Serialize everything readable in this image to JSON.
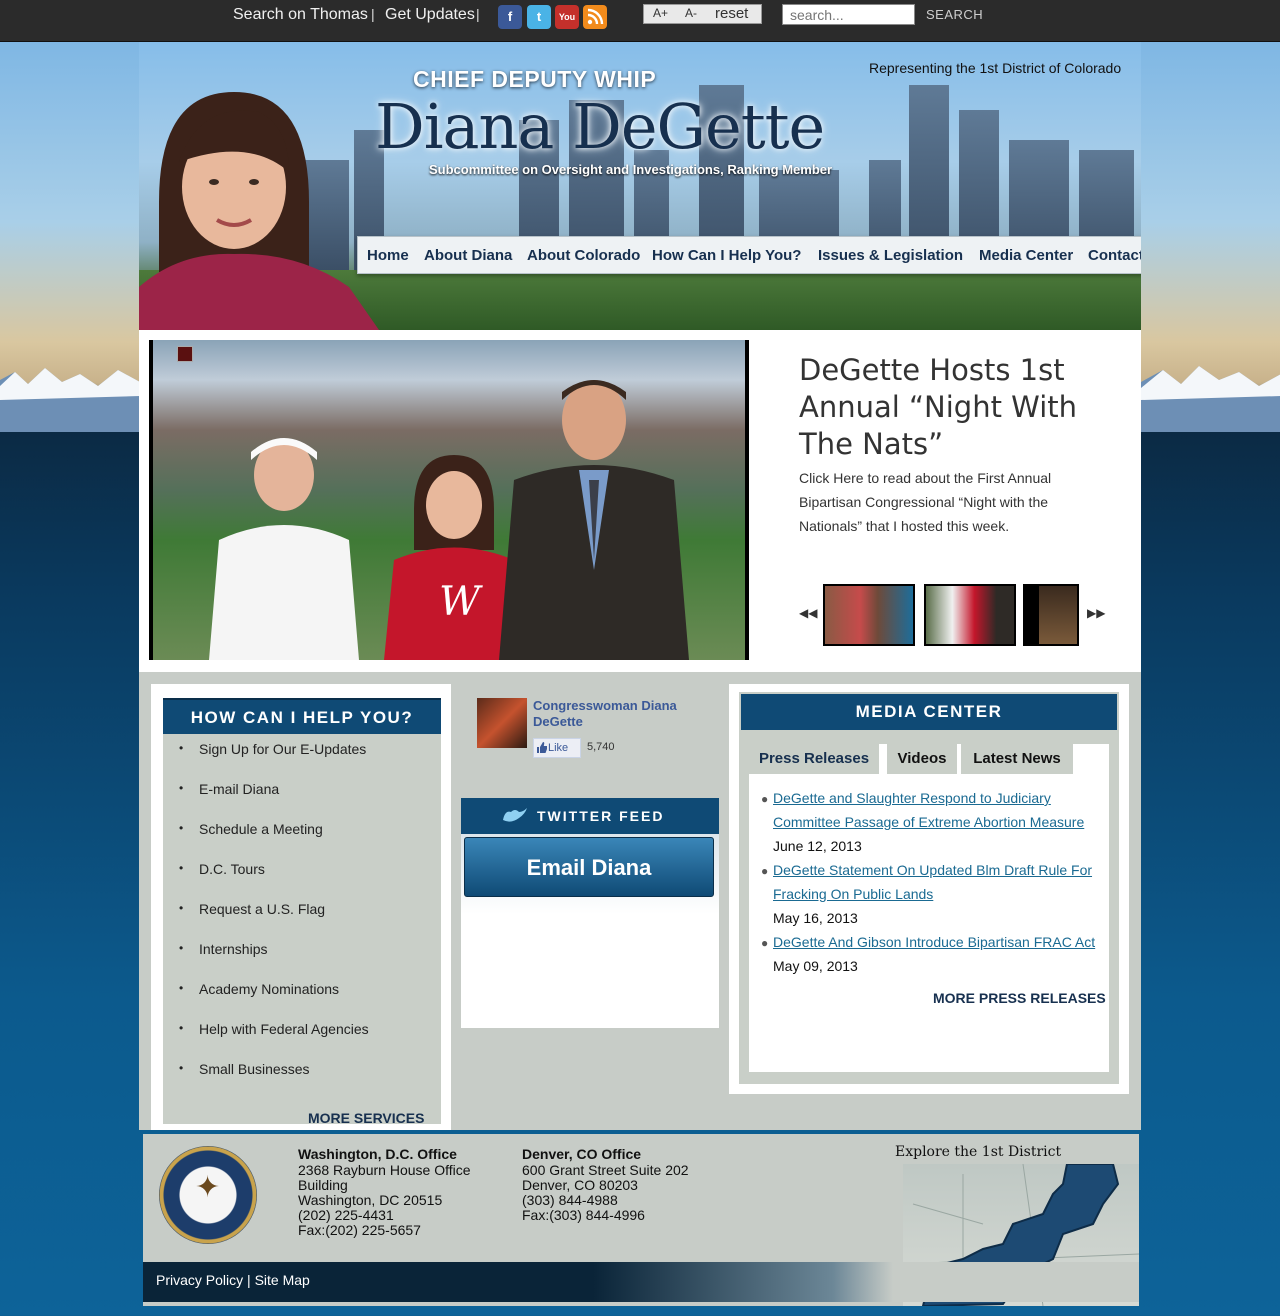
{
  "topbar": {
    "search_thomas": "Search on Thomas",
    "sep1": "|",
    "get_updates": "Get Updates",
    "sep2": "|",
    "font_increase": "A+",
    "font_decrease": "A-",
    "font_reset": "reset",
    "search_placeholder": "search...",
    "search_button": "SEARCH",
    "social_icons": [
      "facebook-icon",
      "twitter-icon",
      "youtube-icon",
      "rss-icon"
    ]
  },
  "header": {
    "chief_deputy_whip": "CHIEF DEPUTY WHIP",
    "name": "Diana DeGette",
    "subcommittee": "Subcommittee on Oversight and Investigations, Ranking Member",
    "representing": "Representing the 1st District of Colorado"
  },
  "nav": {
    "items": [
      "Home",
      "About Diana",
      "About Colorado",
      "How Can I Help You?",
      "Issues & Legislation",
      "Media Center",
      "Contact"
    ]
  },
  "slider": {
    "title": "DeGette Hosts 1st Annual “Night With The Nats”",
    "text": "Click Here to read about the First Annual Bipartisan Congressional “Night with the Nationals” that I hosted this week.",
    "prev_icon": "rewind-icon",
    "next_icon": "fast-forward-icon"
  },
  "help": {
    "heading": "HOW CAN I HELP YOU?",
    "items": [
      "Sign Up for Our E-Updates",
      "E-mail Diana",
      "Schedule a Meeting",
      "D.C. Tours",
      "Request a U.S. Flag",
      "Internships",
      "Academy Nominations",
      "Help with Federal Agencies",
      "Small Businesses"
    ],
    "more": "MORE SERVICES"
  },
  "facebook": {
    "name": "Congresswoman Diana DeGette",
    "like_label": "Like",
    "like_count": "5,740"
  },
  "twitter": {
    "heading": "TWITTER FEED",
    "email_button": "Email Diana"
  },
  "media": {
    "heading": "MEDIA CENTER",
    "tabs": [
      "Press Releases",
      "Videos",
      "Latest News"
    ],
    "press_releases": [
      {
        "title": "DeGette and Slaughter Respond to Judiciary Committee Passage of Extreme Abortion Measure",
        "date": "June 12, 2013"
      },
      {
        "title": "DeGette Statement On Updated Blm Draft Rule For Fracking On Public Lands",
        "date": "May 16, 2013"
      },
      {
        "title": "DeGette And Gibson Introduce Bipartisan FRAC Act",
        "date": "May 09, 2013"
      }
    ],
    "more": "MORE PRESS RELEASES"
  },
  "footer": {
    "dc_office": {
      "title": "Washington, D.C. Office",
      "lines": [
        "2368 Rayburn House Office",
        "Building",
        "Washington, DC 20515",
        "(202) 225-4431",
        "Fax:(202) 225-5657"
      ]
    },
    "denver_office": {
      "title": "Denver, CO Office",
      "lines": [
        "600 Grant Street Suite 202",
        "Denver, CO 80203",
        "(303) 844-4988",
        "Fax:(303) 844-4996"
      ]
    },
    "explore": "Explore the 1st District",
    "privacy": "Privacy Policy",
    "links_sep": "|",
    "sitemap": "Site Map"
  },
  "colors": {
    "brand_navy": "#0f4a75",
    "nav_text": "#17304f",
    "link_blue": "#1a6a92",
    "panel_gray": "#c9cfc8"
  }
}
